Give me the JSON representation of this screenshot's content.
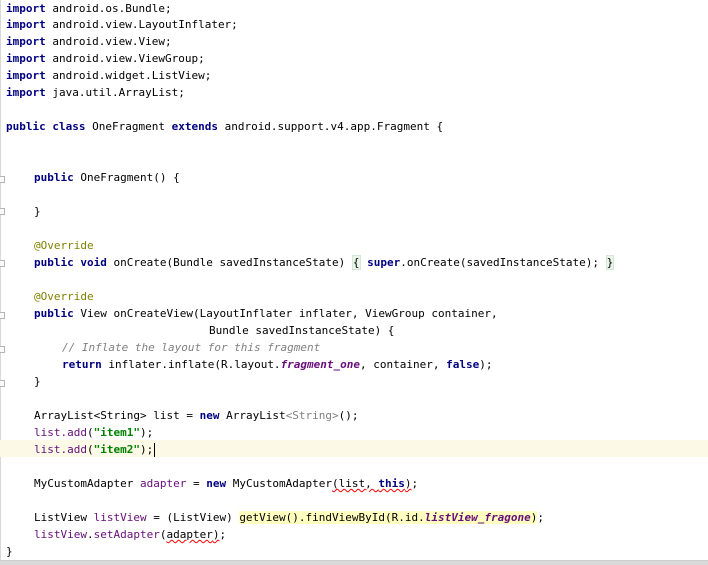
{
  "imports": [
    "android.os.Bundle;",
    "android.view.LayoutInflater;",
    "android.view.View;",
    "android.view.ViewGroup;",
    "android.widget.ListView;",
    "java.util.ArrayList;"
  ],
  "kw": {
    "import": "import",
    "public": "public",
    "class": "class",
    "extends": "extends",
    "void": "void",
    "super": "super",
    "return": "return",
    "new": "new",
    "false": "false",
    "this": "this"
  },
  "class_decl": {
    "name": " OneFragment ",
    "parent": " android.support.v4.app.Fragment {"
  },
  "constructor": {
    "sig": " OneFragment() {",
    "close": "}"
  },
  "annotation": "@Override",
  "oncreate": {
    "head": " onCreate(Bundle savedInstanceState) ",
    "open": "{",
    "body": ".onCreate(savedInstanceState); ",
    "close": "}"
  },
  "oncreateview": {
    "sig1": " View onCreateView(LayoutInflater inflater, ViewGroup container,",
    "sig2": "Bundle savedInstanceState) {",
    "comment": "// Inflate the layout for this fragment",
    "ret_mid": " inflater.inflate(R.layout.",
    "ret_field": "fragment_one",
    "ret_after": ", container, ",
    "ret_end": ");",
    "close": "}"
  },
  "list_decl": {
    "pre": "ArrayList<String> list = ",
    "mid": " ArrayList",
    "generic": "<String>",
    "end": "();"
  },
  "add1": {
    "obj": "list.",
    "method": "add",
    "open": "(",
    "arg": "\"item1\"",
    "end": ");"
  },
  "add2": {
    "obj": "list.",
    "method": "add",
    "open": "(",
    "arg": "\"item2\"",
    "end": ");"
  },
  "adapter_decl": {
    "type": "MyCustomAdapter ",
    "var": "adapter",
    "eq": " = ",
    "cls": " MyCustomAdapter",
    "args_open": "(list, ",
    "args_end": ")",
    "semi": ";"
  },
  "listview_decl": {
    "type": "ListView ",
    "var": "listView",
    "cast": " = (ListView) ",
    "call": "getView().findViewById(R.id.",
    "field": "listView_fragone",
    "close": ")",
    "semi": ";"
  },
  "setadapter": {
    "obj": "listView",
    "dot": ".",
    "method": "setAdapter",
    "open": "(",
    "arg": "adapter",
    "close": ")",
    "semi": ";"
  },
  "final_close": "}"
}
